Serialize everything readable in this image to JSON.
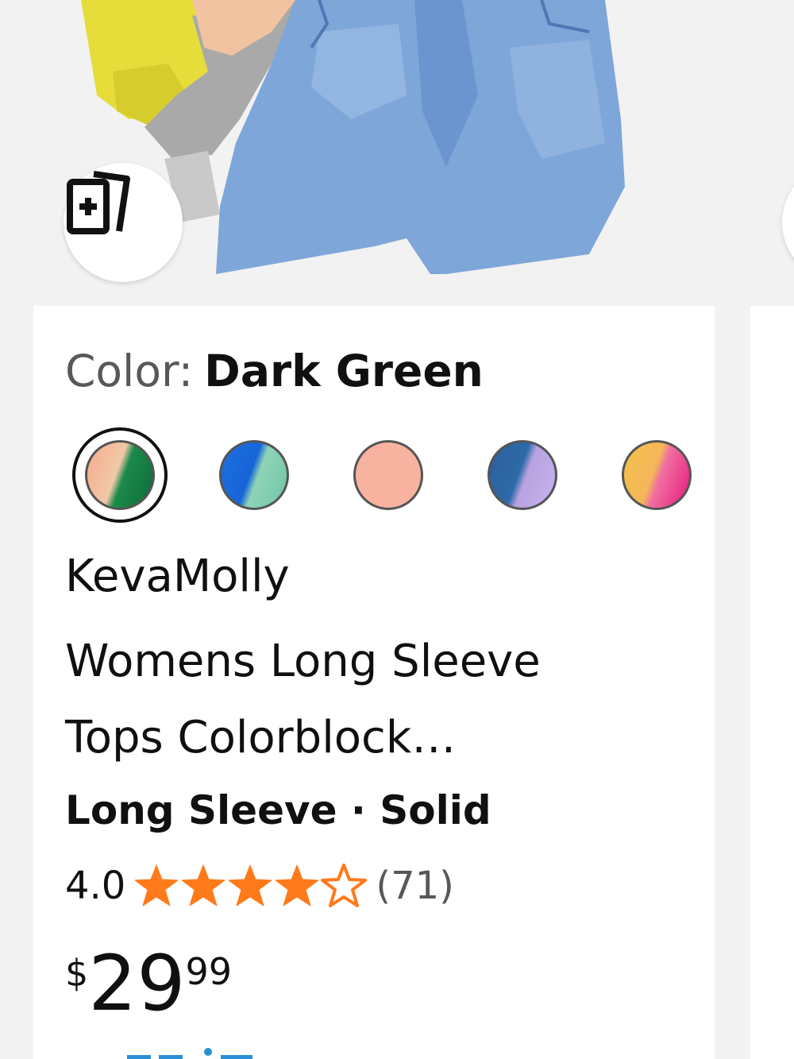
{
  "product": {
    "color_label": "Color:",
    "color_value": "Dark Green",
    "brand": "KevaMolly",
    "title_line1": "Womens Long Sleeve",
    "title_line2": "Tops Colorblock…",
    "attributes": "Long Sleeve · Solid",
    "rating": "4.0",
    "rating_stars": 4,
    "review_count": "(71)",
    "price_symbol": "$",
    "price_whole": "29",
    "price_fraction": "99"
  },
  "swatches": [
    {
      "name": "swatch-dark-green",
      "colors": [
        "#f6a98a",
        "#f0c9a8",
        "#1c8a4a",
        "#0e6b3a"
      ],
      "selected": true
    },
    {
      "name": "swatch-blue",
      "colors": [
        "#1f6fe0",
        "#1565d8",
        "#8fd3b8",
        "#6fc6a8"
      ],
      "selected": false
    },
    {
      "name": "swatch-pink",
      "colors": [
        "#f8b3a0",
        "#f8b3a0",
        "#f8b3a0",
        "#f8b3a0"
      ],
      "selected": false
    },
    {
      "name": "swatch-navy-lavender",
      "colors": [
        "#2e5f9b",
        "#2d6aa8",
        "#b8a3e0",
        "#c8b2ef"
      ],
      "selected": false
    },
    {
      "name": "swatch-yellow-magenta",
      "colors": [
        "#f2c24b",
        "#f4b65a",
        "#f06fa0",
        "#e8197d"
      ],
      "selected": false
    }
  ],
  "icons": {
    "compare": "add-to-compare-icon",
    "star_full": "star-filled-icon",
    "star_empty": "star-outline-icon"
  },
  "colors": {
    "star": "#ff7a1a",
    "muted_text": "#565959"
  }
}
